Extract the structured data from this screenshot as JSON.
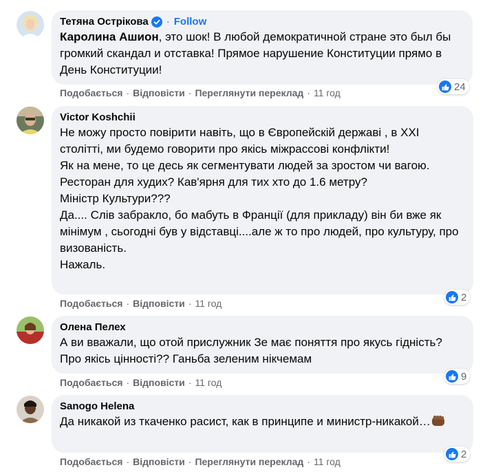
{
  "comments": [
    {
      "author": "Тетяна Острікова",
      "verified": true,
      "follow": "Follow",
      "mention": "Каролина Ашион",
      "text_after_mention": ", это шок! В любой демократичной стране это был бы громкий скандал и отставка! Прямое нарушение Конституции прямо в День Конституции!",
      "actions": {
        "like": "Подобається",
        "reply": "Відповісти",
        "translate": "Переглянути переклад",
        "time": "11 год"
      },
      "reaction_count": "24"
    },
    {
      "author": "Victor Koshchii",
      "text": "Не можу просто повірити навіть, що в Європейскій державі , в XXI столітті, ми будемо говорити про якісь міжрассові конфлікти!\nЯк на мене, то це десь як сегментувати людей за зростом чи вагою.\nРесторан для худих? Кав'ярня для тих хто до 1.6 метру?\nМіністр Культури???\nДа.... Слів забракло, бо мабуть в Франції (для прикладу) він би вже як мінімум , сьогодні був у відставці....але ж то про людей, про культуру, про визованість.\nНажаль.",
      "actions": {
        "like": "Подобається",
        "reply": "Відповісти",
        "time": "11 год"
      },
      "reaction_count": "2"
    },
    {
      "author": "Олена Пелех",
      "text": "А ви вважали, що отой прислужник Зе має поняття про якусь гідність? Про якісь цінності?? Ганьба зеленим нікчемам",
      "actions": {
        "like": "Подобається",
        "reply": "Відповісти",
        "time": "11 год"
      },
      "reaction_count": "9"
    },
    {
      "author": "Sanogo Helena",
      "text": "Да никакой из ткаченко расист, как в принципе и министр-никакой…",
      "emoji": "fist-emoji",
      "actions": {
        "like": "Подобається",
        "reply": "Відповісти",
        "translate": "Переглянути переклад",
        "time": "11 год"
      },
      "reaction_count": "2"
    }
  ],
  "colors": {
    "bubble": "#f0f2f5",
    "link_blue": "#1877f2",
    "secondary_text": "#65676b"
  }
}
